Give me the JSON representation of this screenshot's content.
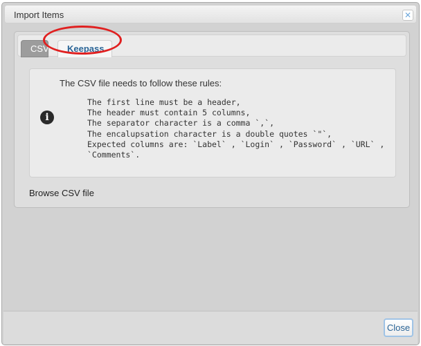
{
  "window": {
    "title": "Import Items",
    "close_icon": "close-x-icon"
  },
  "tabs": [
    {
      "label": "CSV",
      "active": true
    },
    {
      "label": "Keepass",
      "active": false
    }
  ],
  "info": {
    "heading": "The CSV file needs to follow these rules:",
    "icon": "info-icon",
    "rules": [
      "The first line must be a header,",
      "The header must contain 5 columns,",
      "The separator character is a comma `,`,",
      "The encalupsation character is a double quotes `\"`,",
      "Expected columns are: `Label` , `Login` , `Password` , `URL` ,",
      "`Comments`."
    ]
  },
  "browse_label": "Browse CSV file",
  "footer": {
    "close_label": "Close"
  },
  "colors": {
    "annotation": "#e02020",
    "link": "#2a6496"
  }
}
